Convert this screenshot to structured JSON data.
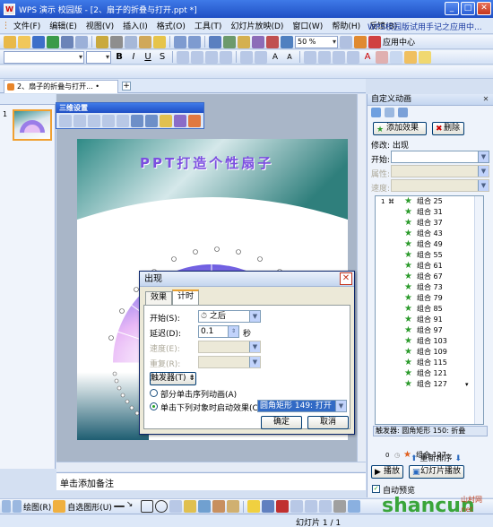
{
  "app": {
    "logo_letter": "W",
    "title": "WPS 演示 校园版 - [2、扇子的折叠与打开.ppt *]"
  },
  "menu": {
    "items": [
      "文件(F)",
      "编辑(E)",
      "视图(V)",
      "插入(I)",
      "格式(O)",
      "工具(T)",
      "幻灯片放映(D)",
      "窗口(W)",
      "帮助(H)",
      "反馈(B)"
    ],
    "promo": "WPS校园版试用手记之应用中..."
  },
  "toolbar": {
    "zoom": "50 %",
    "app_center": "应用中心"
  },
  "doc_tab": {
    "label": "2、扇子的折叠与打开...  •"
  },
  "slide": {
    "title": "PPT打造个性扇子"
  },
  "toolbar_3d": {
    "title": "三维设置"
  },
  "dialog": {
    "title": "出现",
    "tabs": [
      "效果",
      "计时"
    ],
    "start_label": "开始(S):",
    "start_value": "之后",
    "delay_label": "延迟(D):",
    "delay_value": "0.1",
    "delay_unit": "秒",
    "speed_label": "速度(E):",
    "repeat_label": "重复(R):",
    "trigger_button": "触发器(T) ⇟",
    "radio1": "部分单击序列动画(A)",
    "radio2": "单击下列对象时启动效果(C):",
    "trigger_object": "圆角矩形 149: 打开",
    "ok": "确定",
    "cancel": "取消"
  },
  "task_pane": {
    "title": "自定义动画",
    "add_effect": "添加效果",
    "delete": "删除",
    "modify": "修改: 出现",
    "start": "开始:",
    "property": "属性:",
    "speed": "速度:",
    "list_items": [
      "组合 25",
      "组合 31",
      "组合 37",
      "组合 43",
      "组合 49",
      "组合 55",
      "组合 61",
      "组合 67",
      "组合 73",
      "组合 79",
      "组合 85",
      "组合 91",
      "组合 97",
      "组合 103",
      "组合 109",
      "组合 115",
      "组合 121",
      "组合 127"
    ],
    "first_index": "1",
    "trigger_label": "触发器: 圆角矩形 150: 折叠",
    "trigger_item_index": "0",
    "trigger_item": "组合 127",
    "reorder": "重新排序",
    "play": "播放",
    "slideshow": "幻灯片播放",
    "autopreview": "自动预览"
  },
  "notes": {
    "placeholder": "单击添加备注"
  },
  "drawbar": {
    "draw": "绘图(R)",
    "autoshape": "自选图形(U)"
  },
  "status": {
    "slide_count": "幻灯片 1 / 1"
  },
  "leftpane": {
    "slide_number": "1"
  },
  "watermark": {
    "text": "shancun",
    "sub": ".net",
    "cn": "山村网"
  }
}
